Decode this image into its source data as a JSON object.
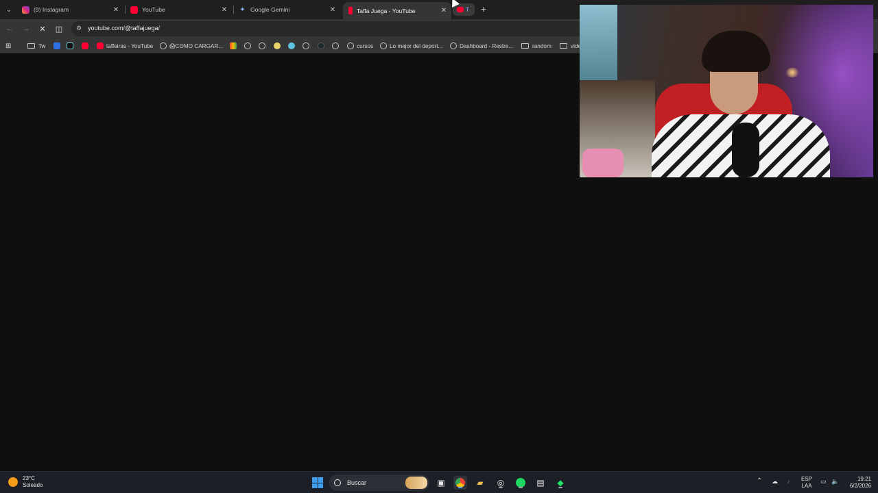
{
  "browser": {
    "tabs": [
      {
        "label": "(9) Instagram",
        "favicon": "instagram-icon",
        "active": false
      },
      {
        "label": "YouTube",
        "favicon": "youtube-icon",
        "active": false
      },
      {
        "label": "Google Gemini",
        "favicon": "gemini-icon",
        "active": false
      },
      {
        "label": "Taffa Juega - YouTube",
        "favicon": "youtube-icon",
        "active": true
      },
      {
        "label": "T",
        "favicon": "youtube-icon",
        "active": false
      }
    ],
    "new_tab_label": "+",
    "url": "youtube.com/@taffajuega/",
    "bookmarks": [
      {
        "label": "Tw",
        "icon": "folder-icon"
      },
      {
        "label": "",
        "icon": "tiktok-icon"
      },
      {
        "label": "",
        "icon": "youtube-icon"
      },
      {
        "label": "taffeiras - YouTube",
        "icon": "youtube-icon"
      },
      {
        "label": "😱COMO CARGAR...",
        "icon": "globe-icon"
      },
      {
        "label": "cursos",
        "icon": "globe-icon"
      },
      {
        "label": "Lo mejor del deport...",
        "icon": "globe-icon"
      },
      {
        "label": "Dashboard - Restre...",
        "icon": "globe-icon"
      },
      {
        "label": "random",
        "icon": "folder-icon"
      },
      {
        "label": "vide",
        "icon": "folder-icon"
      }
    ]
  },
  "taskbar": {
    "weather_temp": "23°C",
    "weather_desc": "Soleado",
    "search_placeholder": "Buscar",
    "lang_top": "ESP",
    "lang_bottom": "LAA",
    "time": "19:21",
    "date": "6/2/2026"
  },
  "colors": {
    "accent_blue": "#3ea0f0",
    "youtube_red": "#ff0033",
    "weather_sun": "#f59d16"
  }
}
